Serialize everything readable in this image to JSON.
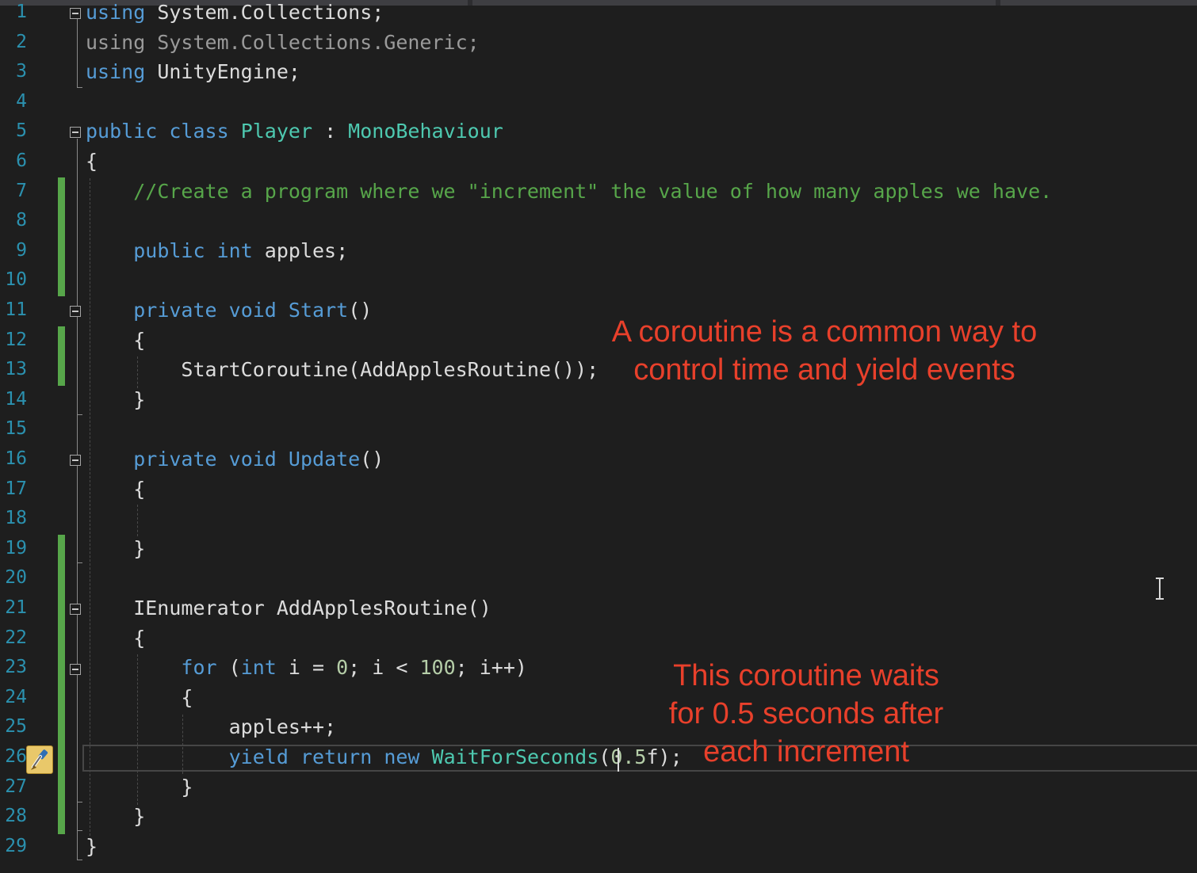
{
  "editor": {
    "lines": [
      {
        "number": "1",
        "tokens": [
          [
            "kw",
            "using"
          ],
          [
            "df",
            " System.Collections;"
          ]
        ]
      },
      {
        "number": "2",
        "tokens": [
          [
            "dim",
            "using System.Collections.Generic;"
          ]
        ]
      },
      {
        "number": "3",
        "tokens": [
          [
            "kw",
            "using"
          ],
          [
            "df",
            " UnityEngine;"
          ]
        ]
      },
      {
        "number": "4",
        "tokens": []
      },
      {
        "number": "5",
        "tokens": [
          [
            "kw",
            "public"
          ],
          [
            "df",
            " "
          ],
          [
            "kw",
            "class"
          ],
          [
            "df",
            " "
          ],
          [
            "ty",
            "Player"
          ],
          [
            "df",
            " : "
          ],
          [
            "ty",
            "MonoBehaviour"
          ]
        ]
      },
      {
        "number": "6",
        "tokens": [
          [
            "df",
            "{"
          ]
        ]
      },
      {
        "number": "7",
        "tokens": [
          [
            "df",
            "    "
          ],
          [
            "cm",
            "//Create a program where we \"increment\" the value of how many apples we have."
          ]
        ]
      },
      {
        "number": "8",
        "tokens": []
      },
      {
        "number": "9",
        "tokens": [
          [
            "df",
            "    "
          ],
          [
            "kw",
            "public"
          ],
          [
            "df",
            " "
          ],
          [
            "kw",
            "int"
          ],
          [
            "df",
            " apples;"
          ]
        ]
      },
      {
        "number": "10",
        "tokens": []
      },
      {
        "number": "11",
        "tokens": [
          [
            "df",
            "    "
          ],
          [
            "kw",
            "private"
          ],
          [
            "df",
            " "
          ],
          [
            "kw",
            "void"
          ],
          [
            "df",
            " "
          ],
          [
            "kw",
            "Start"
          ],
          [
            "df",
            "()"
          ]
        ]
      },
      {
        "number": "12",
        "tokens": [
          [
            "df",
            "    {"
          ]
        ]
      },
      {
        "number": "13",
        "tokens": [
          [
            "df",
            "        StartCoroutine(AddApplesRoutine());"
          ]
        ]
      },
      {
        "number": "14",
        "tokens": [
          [
            "df",
            "    }"
          ]
        ]
      },
      {
        "number": "15",
        "tokens": []
      },
      {
        "number": "16",
        "tokens": [
          [
            "df",
            "    "
          ],
          [
            "kw",
            "private"
          ],
          [
            "df",
            " "
          ],
          [
            "kw",
            "void"
          ],
          [
            "df",
            " "
          ],
          [
            "kw",
            "Update"
          ],
          [
            "df",
            "()"
          ]
        ]
      },
      {
        "number": "17",
        "tokens": [
          [
            "df",
            "    {"
          ]
        ]
      },
      {
        "number": "18",
        "tokens": []
      },
      {
        "number": "19",
        "tokens": [
          [
            "df",
            "    }"
          ]
        ]
      },
      {
        "number": "20",
        "tokens": []
      },
      {
        "number": "21",
        "tokens": [
          [
            "df",
            "    IEnumerator AddApplesRoutine()"
          ]
        ]
      },
      {
        "number": "22",
        "tokens": [
          [
            "df",
            "    {"
          ]
        ]
      },
      {
        "number": "23",
        "tokens": [
          [
            "df",
            "        "
          ],
          [
            "kw",
            "for"
          ],
          [
            "df",
            " ("
          ],
          [
            "kw",
            "int"
          ],
          [
            "df",
            " i = "
          ],
          [
            "nm",
            "0"
          ],
          [
            "df",
            "; i < "
          ],
          [
            "nm",
            "100"
          ],
          [
            "df",
            "; i++)"
          ]
        ]
      },
      {
        "number": "24",
        "tokens": [
          [
            "df",
            "        {"
          ]
        ]
      },
      {
        "number": "25",
        "tokens": [
          [
            "df",
            "            apples++;"
          ]
        ]
      },
      {
        "number": "26",
        "tokens": [
          [
            "df",
            "            "
          ],
          [
            "kw",
            "yield"
          ],
          [
            "df",
            " "
          ],
          [
            "kw",
            "return"
          ],
          [
            "df",
            " "
          ],
          [
            "kw",
            "new"
          ],
          [
            "df",
            " "
          ],
          [
            "ty",
            "WaitForSeconds"
          ],
          [
            "df",
            "("
          ],
          [
            "nm",
            "0.5"
          ],
          [
            "df",
            "f);"
          ]
        ]
      },
      {
        "number": "27",
        "tokens": [
          [
            "df",
            "        }"
          ]
        ]
      },
      {
        "number": "28",
        "tokens": [
          [
            "df",
            "    }"
          ]
        ]
      },
      {
        "number": "29",
        "tokens": [
          [
            "df",
            "}"
          ]
        ]
      }
    ]
  },
  "annotations": {
    "coroutine_note": {
      "line1": "A coroutine is a common way to",
      "line2": "control time and yield events"
    },
    "wait_note": {
      "line1": "This coroutine waits",
      "line2": "for 0.5 seconds after",
      "line3": "each increment"
    }
  },
  "icons": {
    "quick_actions": "screwdriver-brush-icon",
    "cursor": "text-ibeam-icon"
  },
  "colors": {
    "keyword": "#569cd6",
    "type": "#4ec9b0",
    "comment": "#57a64a",
    "number": "#b5cea8",
    "line_number": "#2b91af",
    "annotation": "#e8402b",
    "background": "#1e1e1e"
  }
}
